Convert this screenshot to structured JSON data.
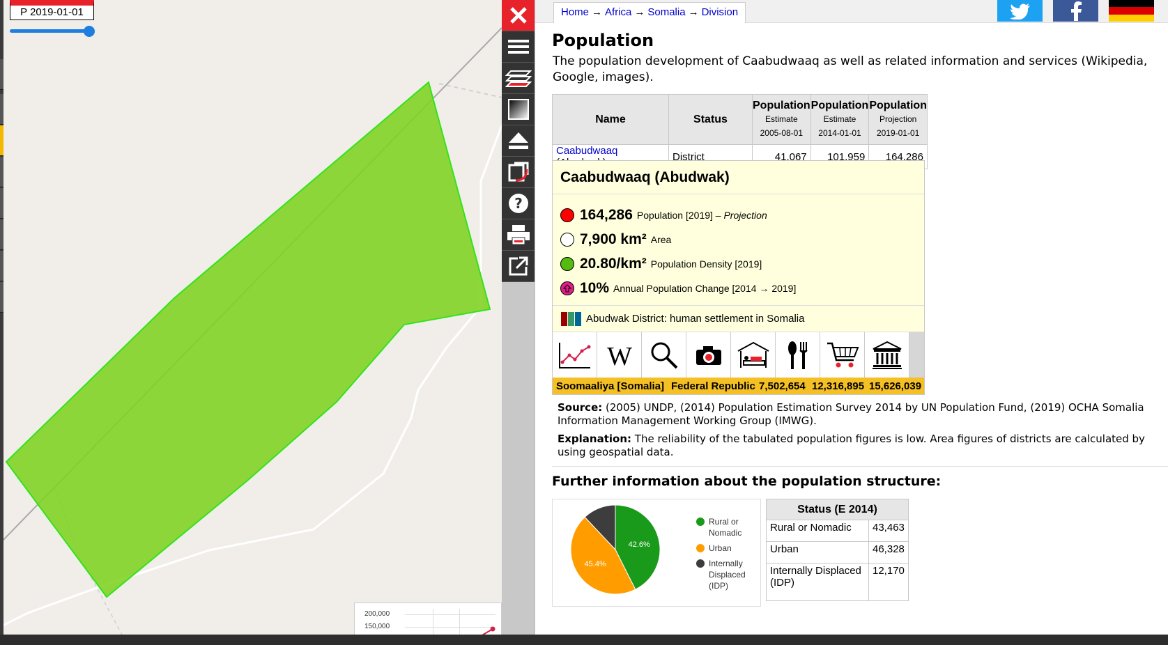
{
  "map": {
    "date_label": "P 2019-01-01",
    "mini_chart_ticks": [
      "200,000",
      "150,000"
    ]
  },
  "toolbar": [
    {
      "name": "close-button",
      "icon": "close-icon"
    },
    {
      "name": "menu-button",
      "icon": "menu-icon"
    },
    {
      "name": "layers-button",
      "icon": "layers-icon"
    },
    {
      "name": "contrast-button",
      "icon": "contrast-icon"
    },
    {
      "name": "eject-button",
      "icon": "eject-icon"
    },
    {
      "name": "refresh-button",
      "icon": "refresh-icon"
    },
    {
      "name": "help-button",
      "icon": "help-icon"
    },
    {
      "name": "print-button",
      "icon": "print-icon"
    },
    {
      "name": "share-button",
      "icon": "share-icon"
    }
  ],
  "breadcrumb": {
    "items": [
      "Home",
      "Africa",
      "Somalia",
      "Division"
    ],
    "separator": "→"
  },
  "page": {
    "title": "Population",
    "intro": "The population development of Caabudwaaq as well as related information and services (Wikipedia, Google, images)."
  },
  "table": {
    "headers": {
      "name": "Name",
      "status": "Status",
      "cols": [
        {
          "title": "Population",
          "kind": "Estimate",
          "date": "2005-08-01"
        },
        {
          "title": "Population",
          "kind": "Estimate",
          "date": "2014-01-01"
        },
        {
          "title": "Population",
          "kind": "Projection",
          "date": "2019-01-01"
        }
      ]
    },
    "row": {
      "name": "Caabudwaaq",
      "alt_name": "(Abudwak)",
      "status": "District",
      "values": [
        "41,067",
        "101,959",
        "164,286"
      ]
    }
  },
  "info": {
    "title": "Caabudwaaq (Abudwak)",
    "stats": [
      {
        "value": "164,286",
        "label": "Population [2019] – ",
        "label_italic": "Projection",
        "color": "#ff0000"
      },
      {
        "value": "7,900 km²",
        "label": "Area",
        "label_italic": "",
        "color": "#ffffff"
      },
      {
        "value": "20.80/km²",
        "label": "Population Density [2019]",
        "label_italic": "",
        "color": "#55bb11"
      },
      {
        "value": "10%",
        "label": "Annual Population Change [2014 → 2019]",
        "label_italic": "",
        "color": "#e01e8a"
      }
    ],
    "wiki_text": "Abudwak District: human settlement in Somalia",
    "services": [
      "chart-icon",
      "wikipedia-icon",
      "search-icon",
      "camera-icon",
      "hotel-icon",
      "restaurant-icon",
      "shopping-icon",
      "museum-icon"
    ],
    "country_row": {
      "name": "Soomaaliya [Somalia]",
      "status": "Federal Republic",
      "values": [
        "7,502,654",
        "12,316,895",
        "15,626,039"
      ]
    }
  },
  "source": {
    "label": "Source:",
    "text": " (2005) UNDP, (2014) Population Estimation Survey 2014 by UN Population Fund, (2019) OCHA Somalia Information Management Working Group (IMWG)."
  },
  "explanation": {
    "label": "Explanation:",
    "text": " The reliability of the tabulated population figures is low. Area figures of districts are calculated by using geospatial data."
  },
  "further": {
    "title": "Further information about the population structure:"
  },
  "chart_data": {
    "type": "pie",
    "slices": [
      {
        "label": "Rural or Nomadic",
        "value": 42.6,
        "color": "#1a9a1a",
        "shown_label": "42.6%"
      },
      {
        "label": "Urban",
        "value": 45.4,
        "color": "#ff9d00",
        "shown_label": "45.4%"
      },
      {
        "label": "Internally Displaced (IDP)",
        "value": 12.0,
        "color": "#3d3d3d",
        "shown_label": ""
      }
    ],
    "legend": [
      "Rural or Nomadic",
      "Urban",
      "Internally Displaced (IDP)"
    ],
    "legend_placement": "right"
  },
  "status_table": {
    "header": "Status (E 2014)",
    "rows": [
      {
        "label": "Rural or Nomadic",
        "value": "43,463"
      },
      {
        "label": "Urban",
        "value": "46,328"
      },
      {
        "label": "Internally Displaced (IDP)",
        "value": "12,170"
      }
    ]
  }
}
